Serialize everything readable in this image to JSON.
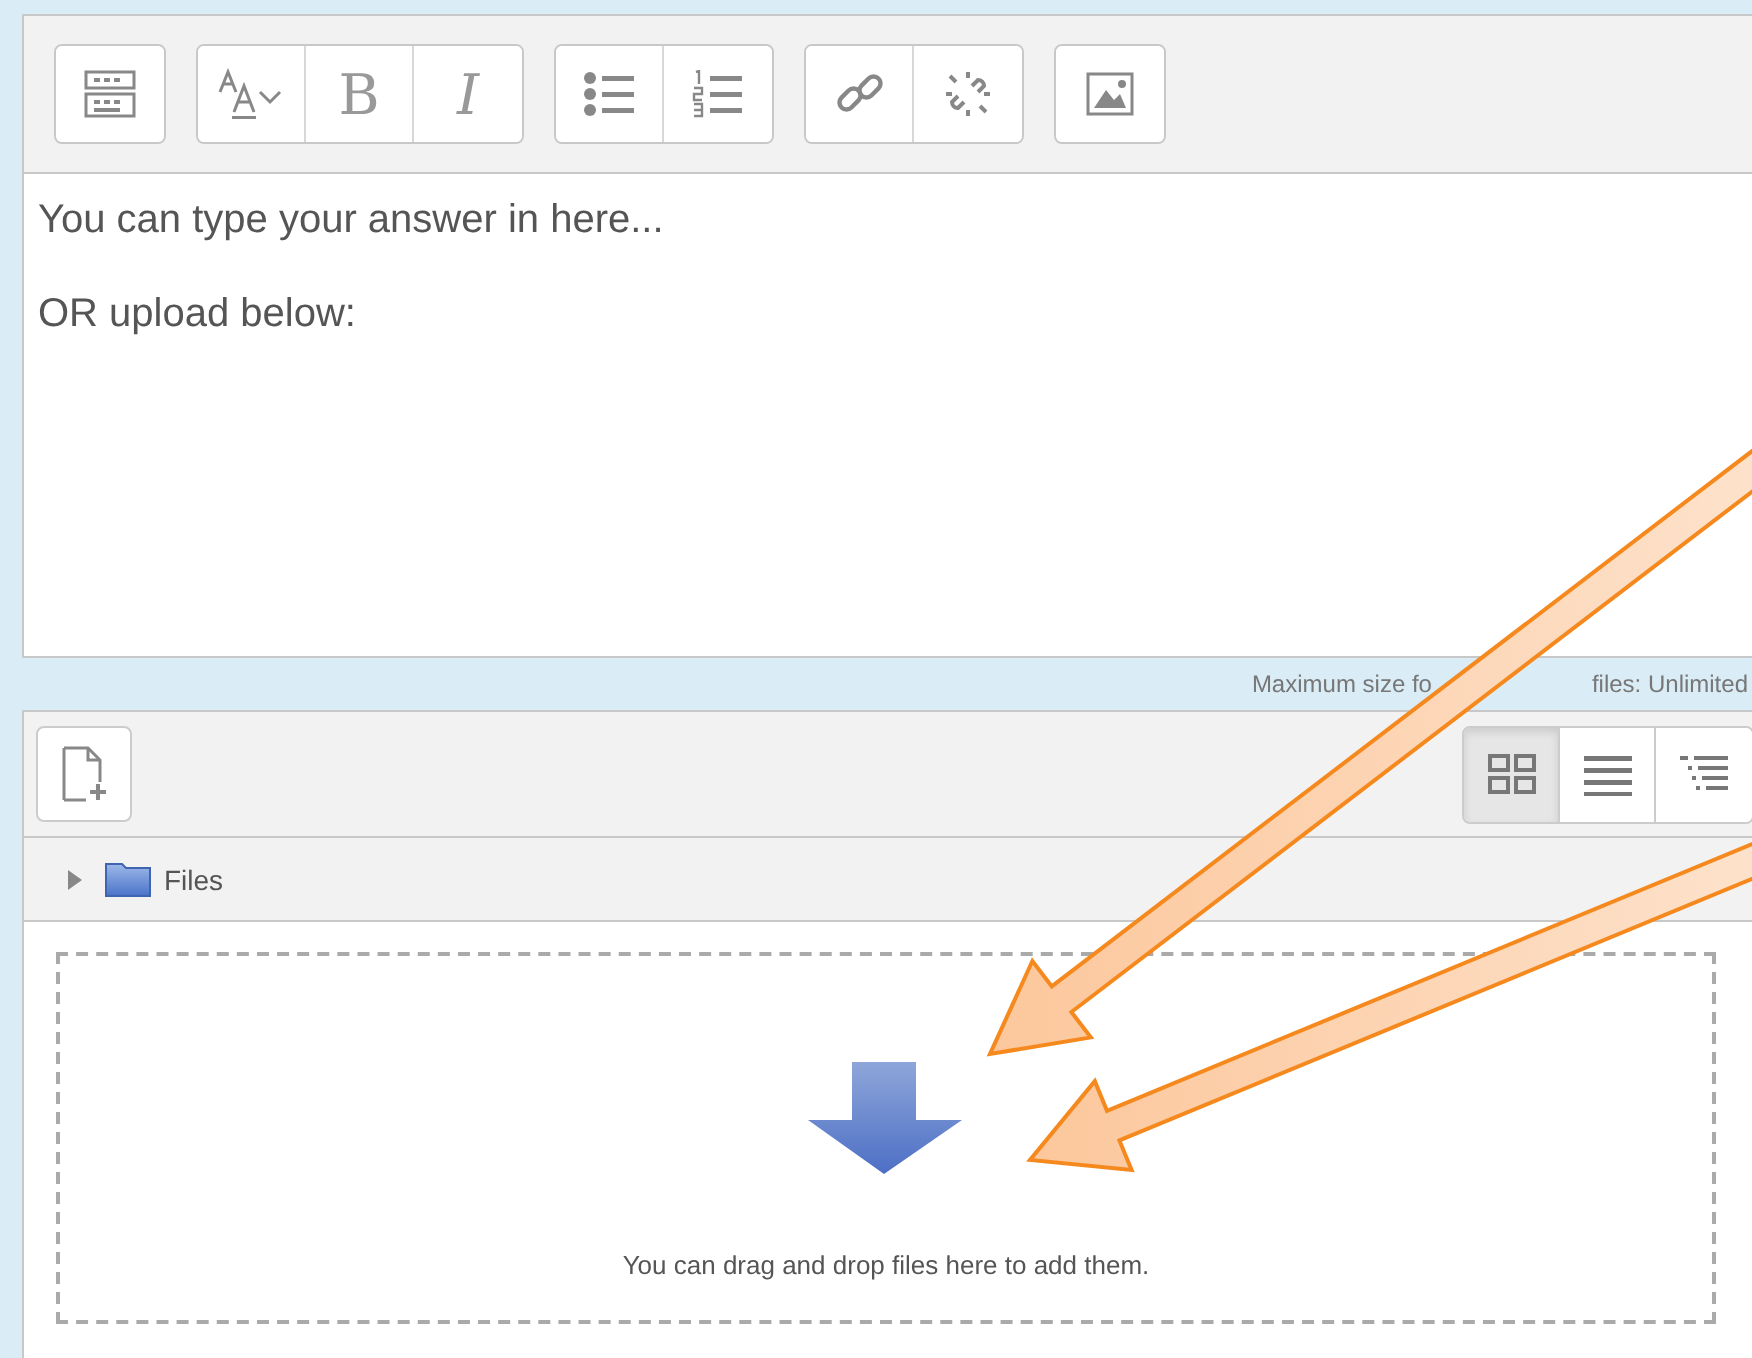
{
  "editor": {
    "toolbar": [
      [
        {
          "kind": "more"
        }
      ],
      [
        {
          "kind": "style"
        },
        {
          "kind": "bold",
          "label": "B"
        },
        {
          "kind": "italic",
          "label": "I"
        }
      ],
      [
        {
          "kind": "bullets"
        },
        {
          "kind": "numbers"
        }
      ],
      [
        {
          "kind": "link"
        },
        {
          "kind": "unlink"
        }
      ],
      [
        {
          "kind": "image"
        }
      ]
    ],
    "lines": [
      "You can type your answer in here...",
      "OR upload below:"
    ]
  },
  "max_size": [
    "Maximum size fo",
    "files: Unlimited"
  ],
  "filepicker": {
    "views": [
      {
        "kind": "icons",
        "selected": true
      },
      {
        "kind": "list",
        "selected": false
      },
      {
        "kind": "tree",
        "selected": false
      }
    ],
    "folder": {
      "label": "Files",
      "expanded": false
    },
    "dropzone_text": "You can drag and drop files here to add them."
  },
  "annotations": [
    {
      "kind": "arrow"
    },
    {
      "kind": "arrow"
    }
  ]
}
